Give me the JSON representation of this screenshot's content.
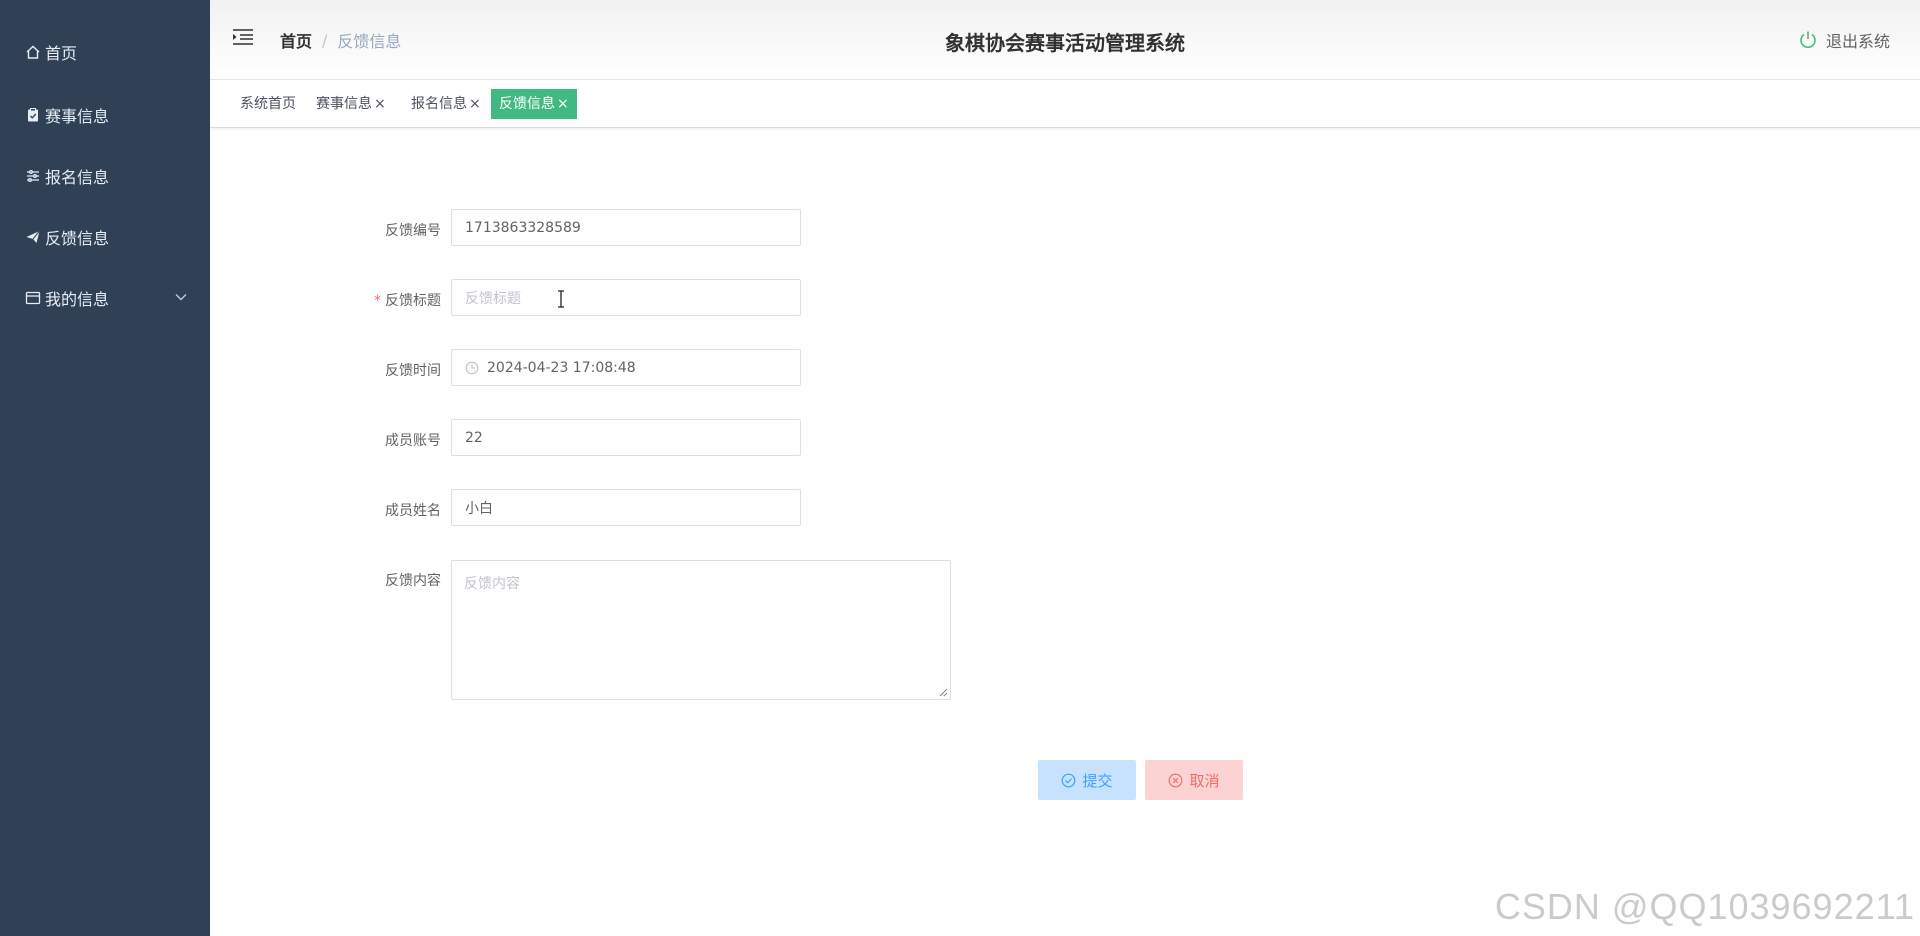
{
  "sidebar": {
    "items": [
      {
        "label": "首页",
        "icon": "home-icon"
      },
      {
        "label": "赛事信息",
        "icon": "clipboard-icon"
      },
      {
        "label": "报名信息",
        "icon": "sliders-icon"
      },
      {
        "label": "反馈信息",
        "icon": "send-icon"
      },
      {
        "label": "我的信息",
        "icon": "window-icon"
      }
    ]
  },
  "header": {
    "breadcrumb": {
      "home": "首页",
      "separator": "/",
      "current": "反馈信息"
    },
    "title": "象棋协会赛事活动管理系统",
    "logout": "退出系统"
  },
  "tags": [
    {
      "label": "系统首页",
      "closable": false,
      "active": false
    },
    {
      "label": "赛事信息",
      "closable": true,
      "active": false
    },
    {
      "label": "报名信息",
      "closable": true,
      "active": false
    },
    {
      "label": "反馈信息",
      "closable": true,
      "active": true
    }
  ],
  "tag_close": "×",
  "form": {
    "feedback_no": {
      "label": "反馈编号",
      "value": "1713863328589"
    },
    "feedback_title": {
      "label": "反馈标题",
      "required_mark": "*",
      "placeholder": "反馈标题"
    },
    "feedback_time": {
      "label": "反馈时间",
      "value": "2024-04-23 17:08:48"
    },
    "member_account": {
      "label": "成员账号",
      "value": "22"
    },
    "member_name": {
      "label": "成员姓名",
      "value": "小白"
    },
    "feedback_content": {
      "label": "反馈内容",
      "placeholder": "反馈内容"
    }
  },
  "buttons": {
    "submit": "提交",
    "cancel": "取消"
  },
  "watermark": "CSDN @QQ1039692211",
  "colors": {
    "sidebar": "#304156",
    "active_tag": "#42b983",
    "submit": "#c6e2ff",
    "cancel": "#fcd3d3"
  }
}
